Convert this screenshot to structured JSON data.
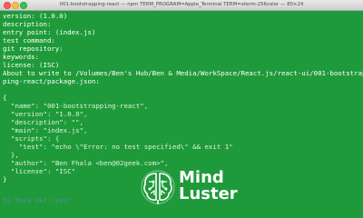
{
  "window": {
    "title": "001-bootstrapping-react — npm TERM_PROGRAM=Apple_Terminal TERM=xterm-256color — 80×24"
  },
  "terminal": {
    "lines": [
      "version: (1.0.0)",
      "description:",
      "entry point: (index.js)",
      "test command:",
      "git repository:",
      "keywords:",
      "license: (ISC)",
      "About to write to /Volumes/Ben's Hub/Ben & Media/WorkSpace/React.js/react-ui/001-bootstrap",
      "ping-react/package.json:",
      "",
      "{",
      "  \"name\": \"001-bootstrapping-react\",",
      "  \"version\": \"1.0.0\",",
      "  \"description\": \"\",",
      "  \"main\": \"index.js\",",
      "  \"scripts\": {",
      "    \"test\": \"echo \\\"Error: no test specified\\\" && exit 1\"",
      "  },",
      "  \"author\": \"Ben Fhala <ben@02geek.com>\",",
      "  \"license\": \"ISC\"",
      "}",
      "",
      "",
      "Is this ok? (yes)"
    ]
  },
  "watermark": {
    "word1": "Mind",
    "word2": "Luster"
  }
}
